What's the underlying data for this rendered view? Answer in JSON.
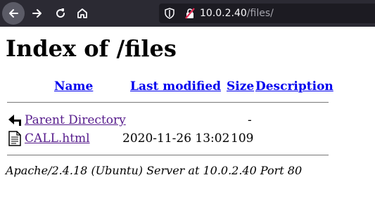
{
  "browser": {
    "url_host": "10.0.2.40",
    "url_path": "/files/"
  },
  "page": {
    "title": "Index of /files",
    "columns": {
      "name": "Name",
      "last_modified": "Last modified",
      "size": "Size",
      "description": "Description"
    },
    "parent": {
      "name": "Parent Directory",
      "size": "-",
      "icon": "back-arrow-icon"
    },
    "rows": [
      {
        "name": "CALL.html",
        "last_modified": "2020-11-26 13:02",
        "size": "109",
        "icon": "text-file-icon"
      }
    ],
    "footer": "Apache/2.4.18 (Ubuntu) Server at 10.0.2.40 Port 80"
  }
}
